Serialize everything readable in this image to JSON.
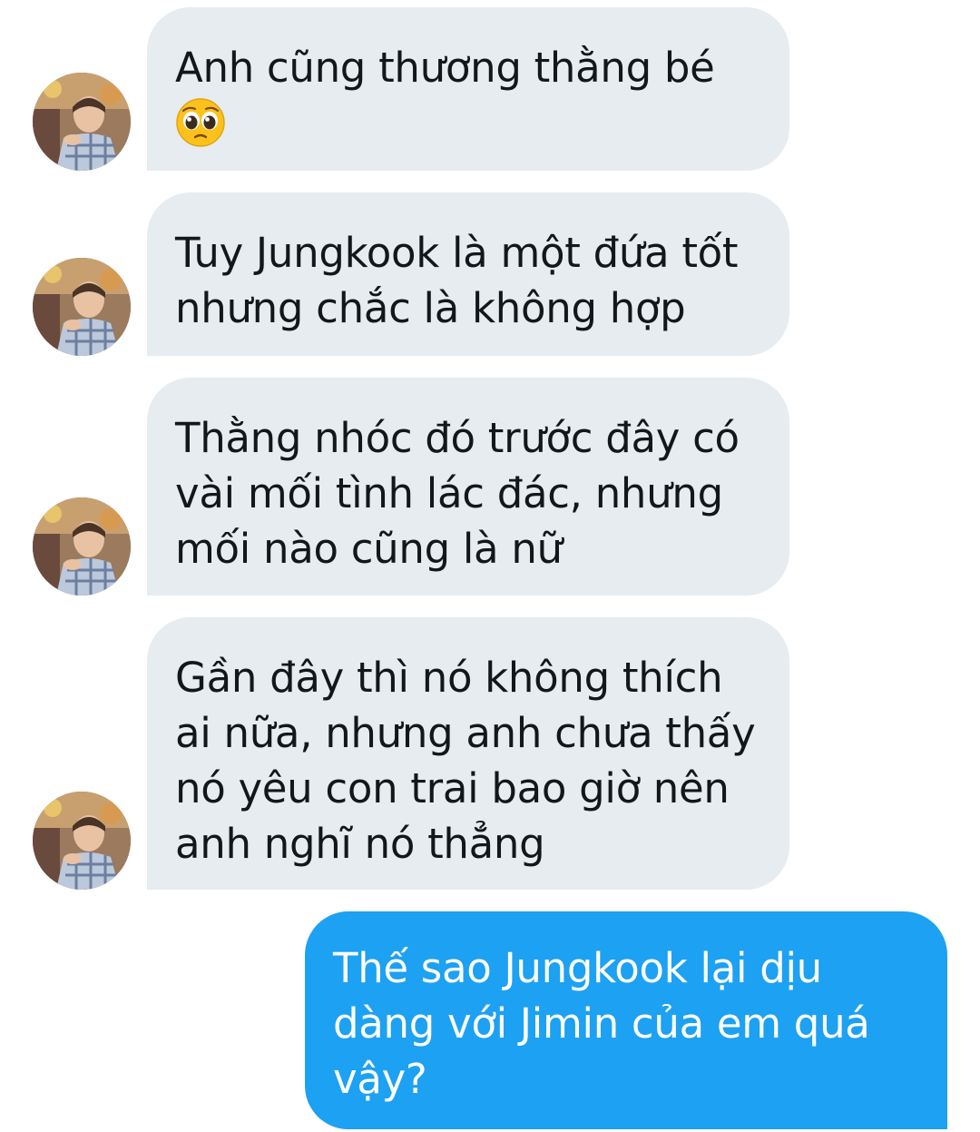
{
  "conversation": {
    "messages": [
      {
        "direction": "incoming",
        "lines": [
          "Anh cũng thương thằng bé"
        ],
        "emoji": "pleading-face-emoji"
      },
      {
        "direction": "incoming",
        "lines": [
          "Tuy Jungkook là một đứa tốt",
          "nhưng chắc là không hợp"
        ]
      },
      {
        "direction": "incoming",
        "lines": [
          "Thằng nhóc đó trước đây có",
          "vài mối tình lác đác, nhưng",
          "mối nào cũng là nữ"
        ]
      },
      {
        "direction": "incoming",
        "lines": [
          "Gần đây thì nó không thích",
          "ai nữa, nhưng anh chưa thấy",
          "nó yêu con trai bao giờ nên",
          "anh nghĩ nó thẳng"
        ]
      },
      {
        "direction": "outgoing",
        "lines": [
          "Thế sao Jungkook lại dịu",
          "dàng với Jimin của em quá",
          "vậy?"
        ]
      }
    ]
  },
  "colors": {
    "incoming_bubble": "#e6ecf0",
    "incoming_text": "#14171a",
    "outgoing_bubble": "#1da1f2",
    "outgoing_text": "#ffffff"
  },
  "icons": {
    "avatar": "profile-photo-avatar",
    "emoji": "pleading-face-emoji"
  }
}
